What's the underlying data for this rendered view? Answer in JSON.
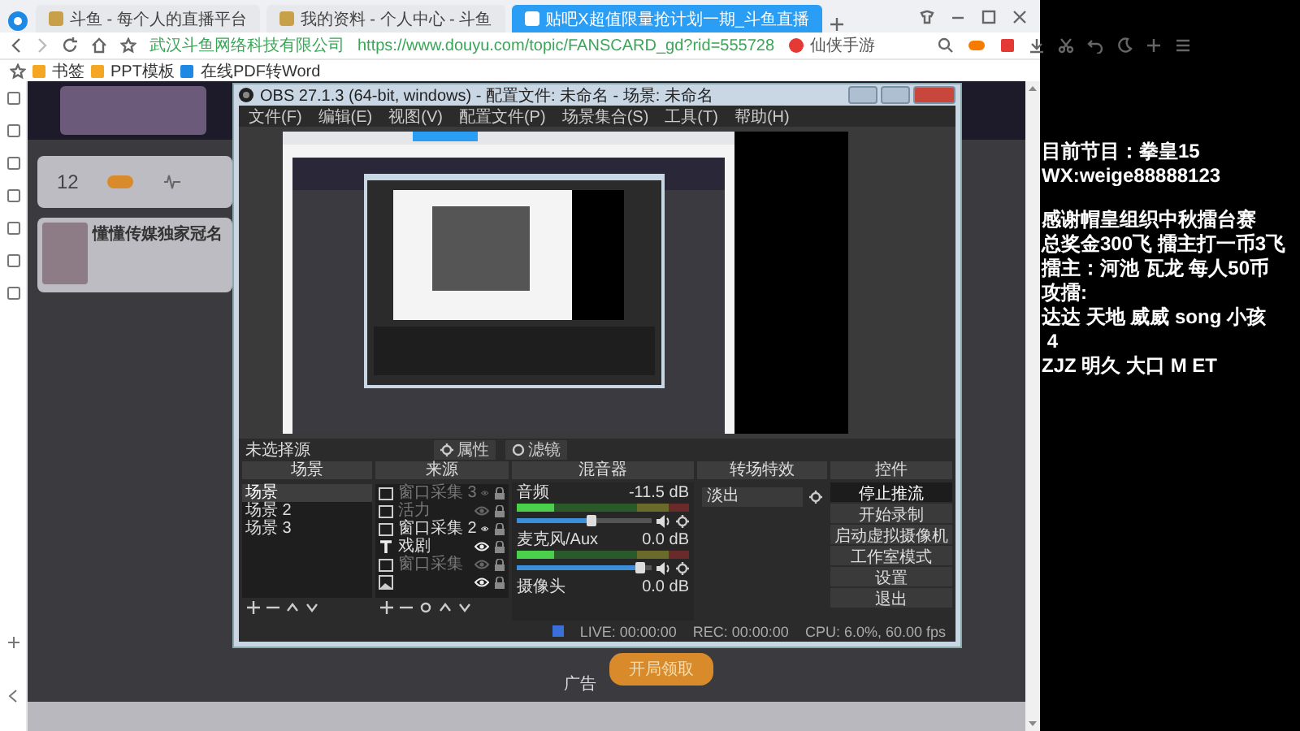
{
  "browser": {
    "tabs": [
      {
        "label": "斗鱼 - 每个人的直播平台",
        "selected": false
      },
      {
        "label": "我的资料 - 个人中心 - 斗鱼",
        "selected": false
      },
      {
        "label": "贴吧X超值限量抢计划一期_斗鱼直播",
        "selected": true
      }
    ],
    "address": {
      "site": "武汉斗鱼网络科技有限公司",
      "url": "https://www.douyu.com/topic/FANSCARD_gd?rid=555728",
      "search": "仙侠手游"
    },
    "bookmarks": [
      "书签",
      "PPT模板",
      "在线PDF转Word"
    ]
  },
  "page": {
    "stat": "12",
    "card_title": "懂懂传媒独家冠名",
    "claim_button": "开局领取",
    "ad_label": "广告"
  },
  "obs": {
    "title": "OBS 27.1.3 (64-bit, windows) - 配置文件: 未命名 - 场景: 未命名",
    "menu": [
      "文件(F)",
      "编辑(E)",
      "视图(V)",
      "配置文件(P)",
      "场景集合(S)",
      "工具(T)",
      "帮助(H)"
    ],
    "selected_source": "未选择源",
    "source_buttons": [
      "属性",
      "滤镜"
    ],
    "docks": [
      "场景",
      "来源",
      "混音器",
      "转场特效",
      "控件"
    ],
    "scenes": [
      {
        "name": "场景",
        "selected": true
      },
      {
        "name": "场景 2",
        "selected": false
      },
      {
        "name": "场景 3",
        "selected": false
      }
    ],
    "sources": [
      {
        "name": "窗口采集 3",
        "kind": "window",
        "visible": false
      },
      {
        "name": "活力",
        "kind": "window",
        "visible": false
      },
      {
        "name": "窗口采集 2",
        "kind": "window",
        "visible": true
      },
      {
        "name": "戏剧",
        "kind": "text",
        "visible": true
      },
      {
        "name": "窗口采集",
        "kind": "window",
        "visible": false
      },
      {
        "kind": "image",
        "visible": true
      }
    ],
    "mixer": [
      {
        "name": "音频",
        "reading": "-11.5 dB",
        "level": 0.55
      },
      {
        "name": "麦克风/Aux",
        "reading": "0.0 dB",
        "level": 0.92
      },
      {
        "name": "摄像头",
        "reading": "0.0 dB"
      }
    ],
    "transition": "淡出",
    "controls": [
      {
        "label": "停止推流",
        "active": true
      },
      {
        "label": "开始录制",
        "active": false
      },
      {
        "label": "启动虚拟摄像机",
        "active": false
      },
      {
        "label": "工作室模式",
        "active": false
      },
      {
        "label": "设置",
        "active": false
      },
      {
        "label": "退出",
        "active": false
      }
    ],
    "status": [
      "LIVE: 00:00:00",
      "REC: 00:00:00",
      "CPU: 6.0%, 60.00 fps"
    ]
  },
  "overlay": {
    "blocks": [
      [
        "目前节目：拳皇15",
        "WX:weige88888123"
      ],
      [
        "感谢帽皇组织中秋擂台赛",
        "总奖金300飞 擂主打一币3飞",
        "擂主：河池 瓦龙 每人50币",
        "攻擂:",
        "达达 天地 威威 song 小孩",
        " 4",
        "ZJZ 明久 大口 M ET"
      ]
    ]
  }
}
